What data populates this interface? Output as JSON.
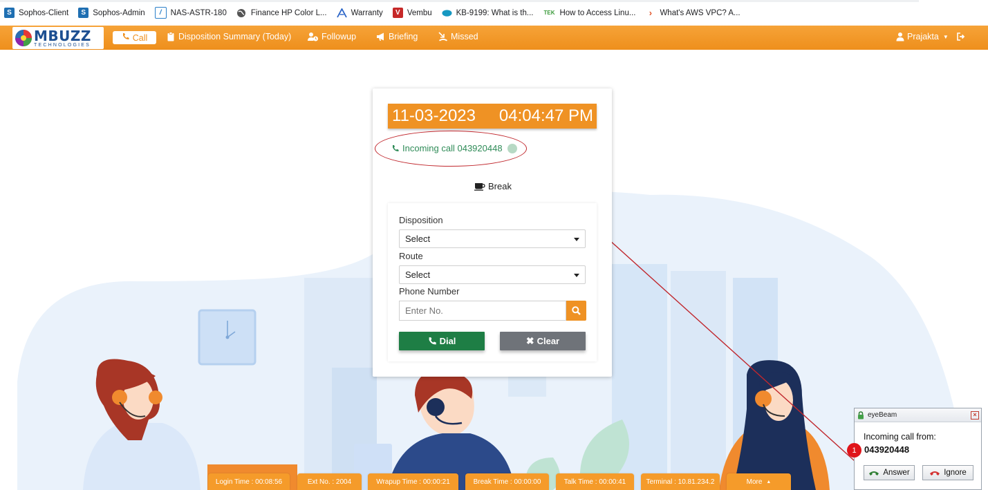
{
  "bookmarks": [
    {
      "label": "Sophos-Client",
      "icon": "sophos-icon",
      "color": "#1f6fb2"
    },
    {
      "label": "Sophos-Admin",
      "icon": "sophos-icon",
      "color": "#1f6fb2"
    },
    {
      "label": "NAS-ASTR-180",
      "icon": "nas-icon",
      "color": "#2a7fc9"
    },
    {
      "label": "Finance HP Color L...",
      "icon": "globe-icon",
      "color": "#444444"
    },
    {
      "label": "Warranty",
      "icon": "warranty-icon",
      "color": "#2a64c7"
    },
    {
      "label": "Vembu",
      "icon": "vembu-icon",
      "color": "#c62828"
    },
    {
      "label": "KB-9199: What is th...",
      "icon": "salesforce-icon",
      "color": "#1798c1"
    },
    {
      "label": "How to Access Linu...",
      "icon": "tek-icon",
      "color": "#3a9a3a"
    },
    {
      "label": "What's AWS VPC? A...",
      "icon": "aws-icon",
      "color": "#e2572c"
    }
  ],
  "navbar": {
    "logo_big": "MBUZZ",
    "logo_small": "TECHNOLOGIES",
    "call_label": "Call",
    "items": [
      {
        "label": "Disposition Summary (Today)",
        "icon": "clipboard-icon"
      },
      {
        "label": "Followup",
        "icon": "user-clock-icon"
      },
      {
        "label": "Briefing",
        "icon": "bullhorn-icon"
      },
      {
        "label": "Missed",
        "icon": "missed-call-icon"
      }
    ],
    "user": "Prajakta",
    "brand_color": "#ef9224"
  },
  "card": {
    "date": "11-03-2023",
    "time": "04:04:47 PM",
    "incoming_text": "Incoming call 043920448",
    "break_label": "Break",
    "disposition_label": "Disposition",
    "disposition_value": "Select",
    "route_label": "Route",
    "route_value": "Select",
    "phone_label": "Phone Number",
    "phone_placeholder": "Enter No.",
    "dial_label": "Dial",
    "clear_label": "Clear",
    "dial_color": "#1e7e45",
    "clear_color": "#6f7379"
  },
  "status_bar": [
    {
      "label": "Login Time : 00:08:56"
    },
    {
      "label": "Ext No. : 2004"
    },
    {
      "label": "Wrapup Time : 00:00:21"
    },
    {
      "label": "Break Time : 00:00:00"
    },
    {
      "label": "Talk Time : 00:00:41"
    },
    {
      "label": "Terminal : 10.81.234.2"
    },
    {
      "label": "More"
    }
  ],
  "eyebeam": {
    "title": "eyeBeam",
    "label": "Incoming call from:",
    "number": "043920448",
    "answer": "Answer",
    "ignore": "Ignore",
    "badge": "1"
  }
}
